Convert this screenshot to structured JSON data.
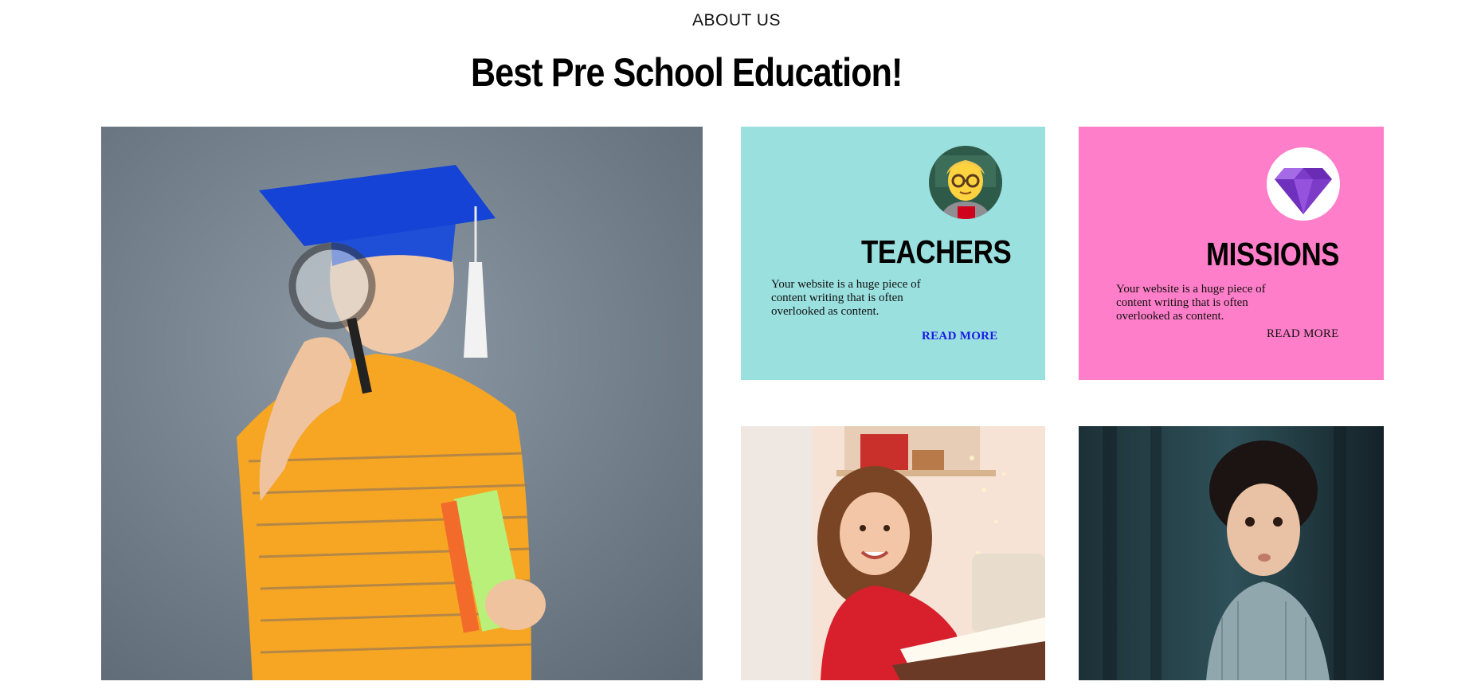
{
  "section_label": "ABOUT US",
  "headline": "Best Pre School Education!",
  "cards": [
    {
      "title": "TEACHERS",
      "text": "Your website is a huge piece of content writing that is often overlooked as content.",
      "link": "READ MORE",
      "icon": "teacher-icon",
      "background": "#99e0df"
    },
    {
      "title": "MISSIONS",
      "text": "Your website is a huge piece of content writing that is often overlooked as content.",
      "link": "READ MORE",
      "icon": "diamond-icon",
      "background": "#ff7ec9"
    }
  ],
  "photos": [
    {
      "name": "graduate-boy-photo"
    },
    {
      "name": "girl-drawing-photo"
    },
    {
      "name": "curly-hair-boy-photo"
    }
  ],
  "colors": {
    "link_blue": "#1a1ae6",
    "teal_card": "#99e0df",
    "pink_card": "#ff7ec9"
  }
}
